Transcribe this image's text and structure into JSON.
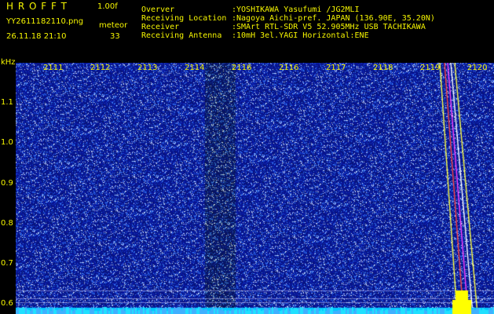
{
  "header": {
    "app_name": "H R O F F T",
    "version": "1.00f",
    "filename": "YY2611182110.png",
    "datetime": "26.11.18 21:10",
    "counter_label": "meteor",
    "counter_value": "33",
    "info_keys": [
      "Overver",
      "Receiving Location",
      "Receiver",
      "Receiving Antenna"
    ],
    "info_values": [
      ":YOSHIKAWA Yasufumi /JG2MLI",
      ":Nagoya Aichi-pref. JAPAN (136.90E, 35.20N)",
      ":SMArt RTL-SDR V5 52.905MHz USB TACHIKAWA",
      ":10mH 3el.YAGI Horizontal:ENE"
    ]
  },
  "y_axis": {
    "unit": "kHz",
    "labels": [
      "1.1",
      "1.0",
      "0.9",
      "0.8",
      "0.7",
      "0.6"
    ],
    "values": [
      1.1,
      1.0,
      0.9,
      0.8,
      0.7,
      0.6
    ],
    "range": [
      0.575,
      1.2
    ]
  },
  "time_axis": {
    "labels": [
      "2111",
      "2112",
      "2113",
      "2114",
      "2116",
      "2116",
      "2117",
      "2118",
      "2119",
      "2120"
    ]
  },
  "colors": {
    "text": "#f5f500",
    "background": "#000000",
    "noise_base": "#0a1a7a",
    "baseline": "#00c8ff"
  }
}
